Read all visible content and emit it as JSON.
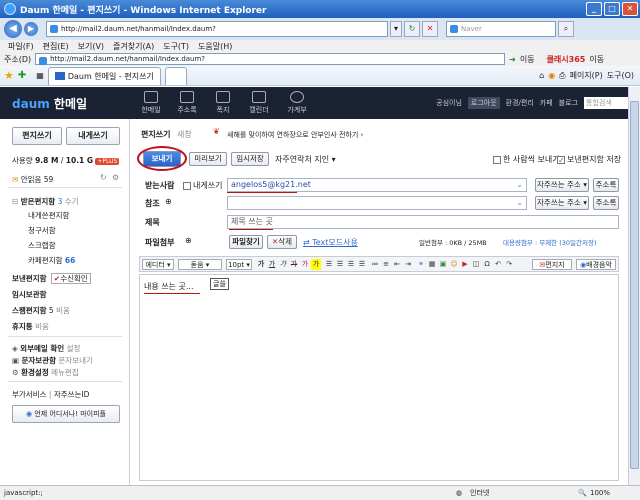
{
  "window": {
    "title": "Daum 한메일 - 편지쓰기 - Windows Internet Explorer",
    "url": "http://mail2.daum.net/hanmail/Index.daum?",
    "search_placeholder": "Naver",
    "url2": "http://mail2.daum.net/hanmail/Index.daum?",
    "go_label": "이동",
    "tab_label": "Daum 한메일 - 편지쓰기",
    "page_menu": "페이지(P)",
    "tools_menu": "도구(O)",
    "go2_label": "이동"
  },
  "menubar": [
    "파일(F)",
    "편집(E)",
    "보기(V)",
    "즐겨찾기(A)",
    "도구(T)",
    "도움말(H)"
  ],
  "address_label": "주소(D)",
  "brand": "클래시365",
  "daum": {
    "logo_daum": "daum",
    "logo_text": "한메일",
    "nav": [
      "한메일",
      "주소록",
      "폭지",
      "캘린더",
      "가계부"
    ],
    "top_links": [
      "공심이님",
      "로그아웃",
      "환경/편리",
      "카페",
      "블로그"
    ],
    "search_placeholder": "통합검색"
  },
  "sidebar": {
    "write_btn": "편지쓰기",
    "self_btn": "내게쓰기",
    "usage_prefix": "사용량",
    "usage_used": "9.8 M",
    "usage_total": "10.1 G",
    "plus_badge": "+PLUS",
    "unread": "안읽음 59",
    "inbox": "받은편지함",
    "inbox_count": "3",
    "inbox_extra": "수기",
    "sub_items": [
      "내게쓴편지함",
      "청구서함",
      "스크랩함"
    ],
    "cafe": "카페편지함",
    "cafe_count": "66",
    "sent": "보낸편지함",
    "sent_confirm": "수신확인",
    "temp": "임시보관함",
    "spam": "스팸편지함",
    "spam_count": "5",
    "spam_extra": "비움",
    "trash": "휴지통",
    "trash_extra": "비움",
    "ext_mail": "외부메일 확인",
    "ext_mail_extra": "설정",
    "sms": "문자보관함",
    "sms_extra": "문자보내기",
    "settings": "환경설정",
    "settings_extra": "메뉴편집",
    "addon": "부가서비스",
    "selfid": "자주쓰는ID",
    "banner": "언제 어디서나! 마이피플"
  },
  "compose": {
    "title": "편지쓰기",
    "new_label": "새창",
    "notice": "새해를 맞이하여 연하장으로 안부인사 전하기 ›",
    "send": "보내기",
    "preview": "미리보기",
    "draft": "임시저장",
    "freq": "자주연락처 지인",
    "private_send": "한 사람씩 보내기",
    "save_sent": "보낸편지함 저장",
    "to_label": "받는사람",
    "self_label": "내게쓰기",
    "to_value": "angelos5@kg21.net",
    "freq_addr": "자주쓰는 주소",
    "address_book": "주소록",
    "cc_label": "참조",
    "subject_label": "제목",
    "subject_value": "제목 쓰는 곳",
    "attach_label": "파일첨부",
    "find_file": "파일찾기",
    "delete": "삭제",
    "text_mode": "Text모드사용",
    "normal_attach": "일반첨부 : 0KB / 25MB",
    "large_attach": "대용량첨부 : 무제한 (30일간저장)",
    "editor_mode": "에디터",
    "font": "돋움",
    "size": "10pt",
    "stationery": "편지지",
    "bgm": "배경음악",
    "body_text": "내용 쓰는 곳...",
    "tooltip": "글쓸"
  },
  "status": {
    "left": "javascript:;",
    "zone": "인터넷",
    "zoom": "100%"
  }
}
